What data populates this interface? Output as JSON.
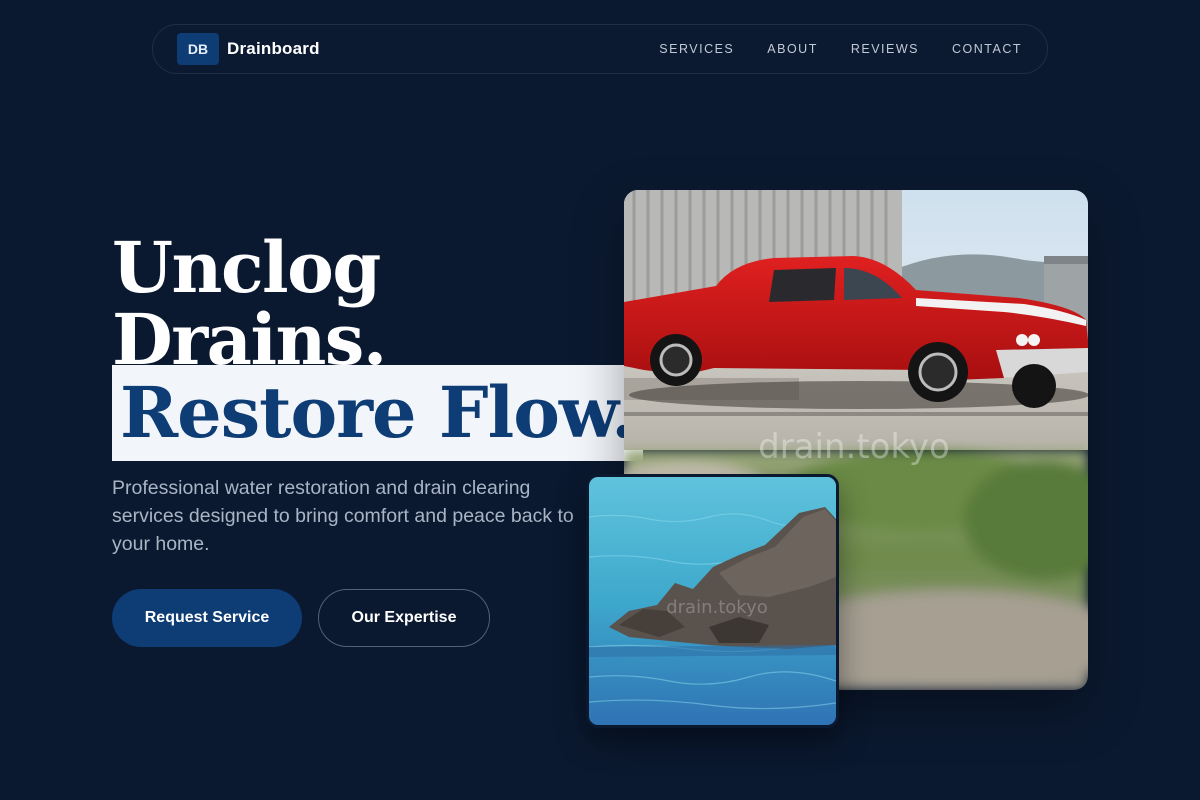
{
  "brand": {
    "logo_text": "DB",
    "name": "Drainboard"
  },
  "nav": {
    "items": [
      {
        "label": "SERVICES"
      },
      {
        "label": "ABOUT"
      },
      {
        "label": "REVIEWS"
      },
      {
        "label": "CONTACT"
      }
    ]
  },
  "hero": {
    "line1": "Unclog",
    "line2": "Drains.",
    "highlight": "Restore Flow.",
    "description": "Professional water restoration and drain clearing services designed to bring comfort and peace back to your home.",
    "primary_cta": "Request Service",
    "secondary_cta": "Our Expertise"
  },
  "images": {
    "main": {
      "subject": "red classic pickup car parked by a building",
      "watermark": "drain.tokyo"
    },
    "small": {
      "subject": "rocks in turquoise sea water",
      "watermark": "drain.tokyo"
    }
  },
  "colors": {
    "background": "#0b1930",
    "accent": "#0e3c75",
    "highlight_bg": "#f2f5fa",
    "muted_text": "#a9b4c5"
  }
}
